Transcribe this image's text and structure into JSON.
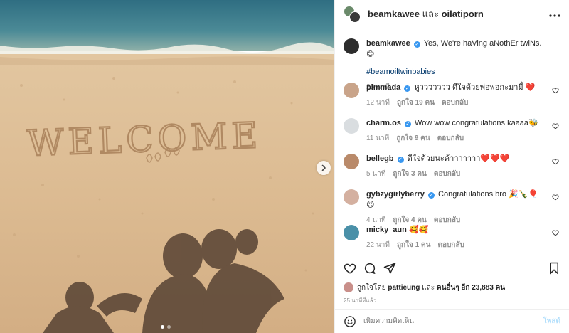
{
  "post": {
    "author": "beamkawee",
    "joiner": "และ",
    "coauthor": "oilatiporn",
    "caption_user": "beamkawee",
    "caption_text": "Yes, We're haVing aNothEr twiNs. 😊",
    "hashtag": "#beamoiltwinbabies",
    "caption_time": "25 นาที",
    "photo_text": "WELCOME"
  },
  "comments": [
    {
      "user": "pimmada",
      "verified": true,
      "text": "หูววววววว ดีใจด้วยพ่อพ่อกะมามี้ ❤️",
      "time": "12 นาที",
      "likes": "ถูกใจ 19 คน",
      "reply": "ตอบกลับ",
      "avatar_color": "#c9a48a"
    },
    {
      "user": "charm.os",
      "verified": true,
      "text": "Wow wow congratulations kaaaa🐝",
      "time": "11 นาที",
      "likes": "ถูกใจ 9 คน",
      "reply": "ตอบกลับ",
      "avatar_color": "#d9dde0"
    },
    {
      "user": "bellegb",
      "verified": true,
      "text": "ดีใจด้วยนะค้าาาาาาา❤️❤️❤️",
      "time": "5 นาที",
      "likes": "ถูกใจ 3 คน",
      "reply": "ตอบกลับ",
      "avatar_color": "#b98a6a"
    },
    {
      "user": "gybzygirlyberry",
      "verified": true,
      "text": "Congratulations bro 🎉🍾🎈😍",
      "time": "4 นาที",
      "likes": "ถูกใจ 4 คน",
      "reply": "ตอบกลับ",
      "avatar_color": "#d4b0a0"
    },
    {
      "user": "micky_aun",
      "verified": false,
      "text": "🥰🥰",
      "time": "22 นาที",
      "likes": "ถูกใจ 1 คน",
      "reply": "ตอบกลับ",
      "avatar_color": "#4a90a8"
    }
  ],
  "likes_line": {
    "prefix": "ถูกใจโดย",
    "user": "pattieung",
    "middle": "และ",
    "others": "คนอื่นๆ อีก 23,883 คน"
  },
  "post_time": "25 นาทีที่แล้ว",
  "comment_box": {
    "placeholder": "เพิ่มความคิดเห็น",
    "post_label": "โพสต์"
  },
  "icons": {
    "more": "more-options-icon",
    "next": "chevron-right-icon",
    "like": "heart-icon",
    "comment": "comment-icon",
    "share": "share-icon",
    "save": "bookmark-icon",
    "emoji": "emoji-icon"
  },
  "colors": {
    "link": "#00376b",
    "verified": "#3897f0",
    "muted": "#8e8e8e",
    "post_disabled": "#b2dffc",
    "sand": "#d9b88f",
    "sea": "#3d7a8c"
  }
}
